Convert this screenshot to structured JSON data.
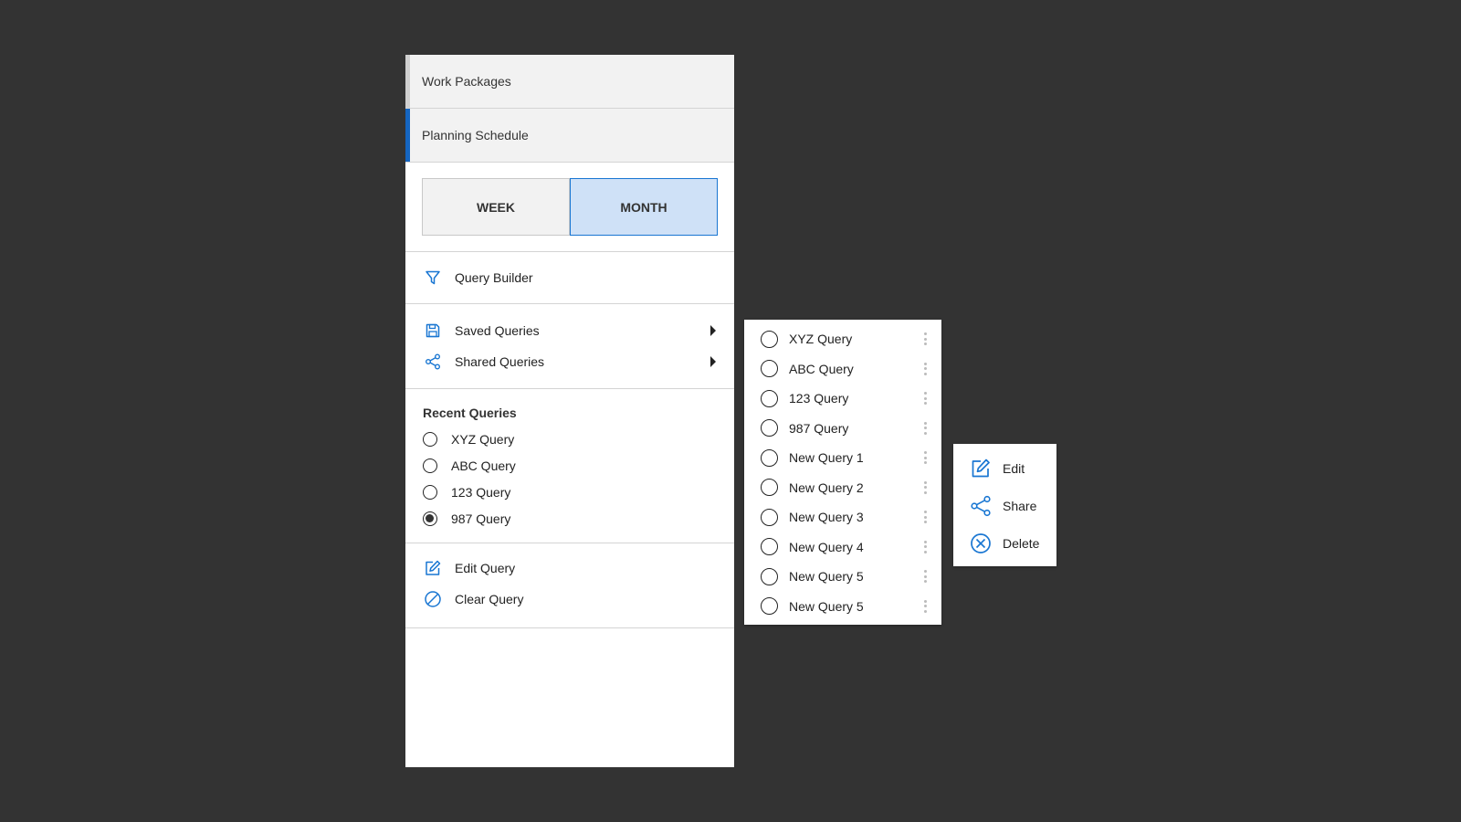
{
  "nav": {
    "work_packages": "Work Packages",
    "planning_schedule": "Planning Schedule"
  },
  "view_toggle": {
    "week": "WEEK",
    "month": "MONTH",
    "selected": "MONTH"
  },
  "menu": {
    "query_builder": "Query Builder",
    "saved_queries": "Saved Queries",
    "shared_queries": "Shared Queries"
  },
  "recent": {
    "heading": "Recent Queries",
    "items": [
      {
        "label": "XYZ Query",
        "checked": false
      },
      {
        "label": "ABC Query",
        "checked": false
      },
      {
        "label": "123 Query",
        "checked": false
      },
      {
        "label": "987 Query",
        "checked": true
      }
    ]
  },
  "query_actions": {
    "edit": "Edit Query",
    "clear": "Clear Query"
  },
  "saved_popup": {
    "items": [
      "XYZ Query",
      "ABC Query",
      "123 Query",
      "987 Query",
      "New Query 1",
      "New Query 2",
      "New Query 3",
      "New Query 4",
      "New Query 5",
      "New Query 5"
    ]
  },
  "item_actions": {
    "edit": "Edit",
    "share": "Share",
    "delete": "Delete"
  },
  "colors": {
    "accent": "#1565c0",
    "icon_blue": "#1976d2",
    "background": "#333333",
    "selected_toggle": "#cfe1f7"
  },
  "icons": {
    "query_builder": "filter-icon",
    "saved_queries": "save-icon",
    "shared_queries": "share-icon",
    "edit_query": "edit-icon",
    "clear_query": "clear-icon",
    "delete": "delete-circle-icon"
  }
}
